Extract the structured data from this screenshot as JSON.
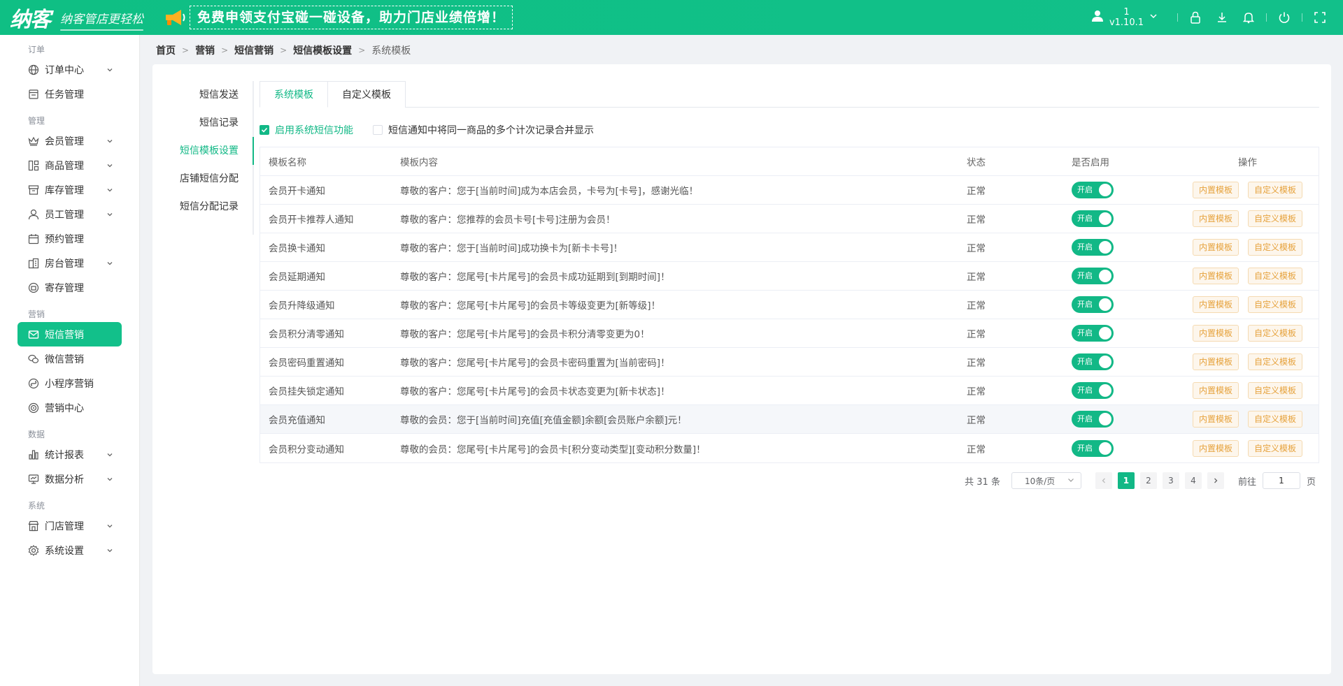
{
  "topbar": {
    "logo_text": "纳客",
    "slogan": "纳客管店更轻松",
    "promo_text": "免费申领支付宝碰一碰设备，助力门店业绩倍增！",
    "user_name": "1",
    "version": "v1.10.1",
    "icons": [
      "user-icon",
      "chevron-down-icon",
      "lock-icon",
      "download-icon",
      "bell-icon",
      "power-icon",
      "fullscreen-icon"
    ]
  },
  "sidebar": {
    "groups": [
      {
        "title": "订单",
        "items": [
          {
            "label": "订单中心",
            "icon": "globe-icon",
            "has_children": true
          },
          {
            "label": "任务管理",
            "icon": "task-icon",
            "has_children": false
          }
        ]
      },
      {
        "title": "管理",
        "items": [
          {
            "label": "会员管理",
            "icon": "crown-icon",
            "has_children": true
          },
          {
            "label": "商品管理",
            "icon": "goods-icon",
            "has_children": true
          },
          {
            "label": "库存管理",
            "icon": "box-icon",
            "has_children": true
          },
          {
            "label": "员工管理",
            "icon": "person-icon",
            "has_children": true
          },
          {
            "label": "预约管理",
            "icon": "calendar-icon",
            "has_children": false
          },
          {
            "label": "房台管理",
            "icon": "building-icon",
            "has_children": true
          },
          {
            "label": "寄存管理",
            "icon": "deposit-icon",
            "has_children": false
          }
        ]
      },
      {
        "title": "营销",
        "items": [
          {
            "label": "短信营销",
            "icon": "mail-icon",
            "has_children": false,
            "active": true
          },
          {
            "label": "微信营销",
            "icon": "wechat-icon",
            "has_children": false
          },
          {
            "label": "小程序营销",
            "icon": "miniprogram-icon",
            "has_children": false
          },
          {
            "label": "营销中心",
            "icon": "target-icon",
            "has_children": false
          }
        ]
      },
      {
        "title": "数据",
        "items": [
          {
            "label": "统计报表",
            "icon": "bar-chart-icon",
            "has_children": true
          },
          {
            "label": "数据分析",
            "icon": "monitor-icon",
            "has_children": true
          }
        ]
      },
      {
        "title": "系统",
        "items": [
          {
            "label": "门店管理",
            "icon": "store-icon",
            "has_children": true
          },
          {
            "label": "系统设置",
            "icon": "gear-icon",
            "has_children": true
          }
        ]
      }
    ]
  },
  "breadcrumb": [
    "首页",
    "营销",
    "短信营销",
    "短信模板设置",
    "系统模板"
  ],
  "subnav": [
    {
      "label": "短信发送"
    },
    {
      "label": "短信记录"
    },
    {
      "label": "短信模板设置",
      "active": true
    },
    {
      "label": "店铺短信分配"
    },
    {
      "label": "短信分配记录"
    }
  ],
  "tabs": [
    {
      "label": "系统模板",
      "active": true
    },
    {
      "label": "自定义模板"
    }
  ],
  "options": {
    "enable_system_sms": {
      "label": "启用系统短信功能",
      "checked": true
    },
    "merge_records": {
      "label": "短信通知中将同一商品的多个计次记录合并显示",
      "checked": false
    }
  },
  "table": {
    "headers": [
      "模板名称",
      "模板内容",
      "状态",
      "是否启用",
      "操作"
    ],
    "switch_label": "开启",
    "op_builtin": "内置模板",
    "op_custom": "自定义模板",
    "rows": [
      {
        "name": "会员开卡通知",
        "content": "尊敬的客户：您于[当前时间]成为本店会员，卡号为[卡号]，感谢光临！",
        "status": "正常"
      },
      {
        "name": "会员开卡推荐人通知",
        "content": "尊敬的客户：您推荐的会员卡号[卡号]注册为会员！",
        "status": "正常"
      },
      {
        "name": "会员换卡通知",
        "content": "尊敬的客户：您于[当前时间]成功换卡为[新卡卡号]！",
        "status": "正常"
      },
      {
        "name": "会员延期通知",
        "content": "尊敬的客户：您尾号[卡片尾号]的会员卡成功延期到[到期时间]！",
        "status": "正常"
      },
      {
        "name": "会员升降级通知",
        "content": "尊敬的客户：您尾号[卡片尾号]的会员卡等级变更为[新等级]！",
        "status": "正常"
      },
      {
        "name": "会员积分清零通知",
        "content": "尊敬的客户：您尾号[卡片尾号]的会员卡积分清零变更为0！",
        "status": "正常"
      },
      {
        "name": "会员密码重置通知",
        "content": "尊敬的客户：您尾号[卡片尾号]的会员卡密码重置为[当前密码]！",
        "status": "正常"
      },
      {
        "name": "会员挂失锁定通知",
        "content": "尊敬的客户：您尾号[卡片尾号]的会员卡状态变更为[新卡状态]！",
        "status": "正常"
      },
      {
        "name": "会员充值通知",
        "content": "尊敬的会员：您于[当前时间]充值[充值金额]余额[会员账户余额]元！",
        "status": "正常",
        "highlight": true
      },
      {
        "name": "会员积分变动通知",
        "content": "尊敬的会员：您尾号[卡片尾号]的会员卡[积分变动类型][变动积分数量]！",
        "status": "正常"
      }
    ]
  },
  "pagination": {
    "total_text": "共 31 条",
    "page_size": "10条/页",
    "pages": [
      "1",
      "2",
      "3",
      "4"
    ],
    "current": "1",
    "goto_label": "前往",
    "goto_value": "1",
    "page_suffix": "页"
  },
  "colors": {
    "brand": "#12b886",
    "topbar": "#10bf84",
    "warning_text": "#e6a23c",
    "warning_bg": "#fdf6ec"
  }
}
